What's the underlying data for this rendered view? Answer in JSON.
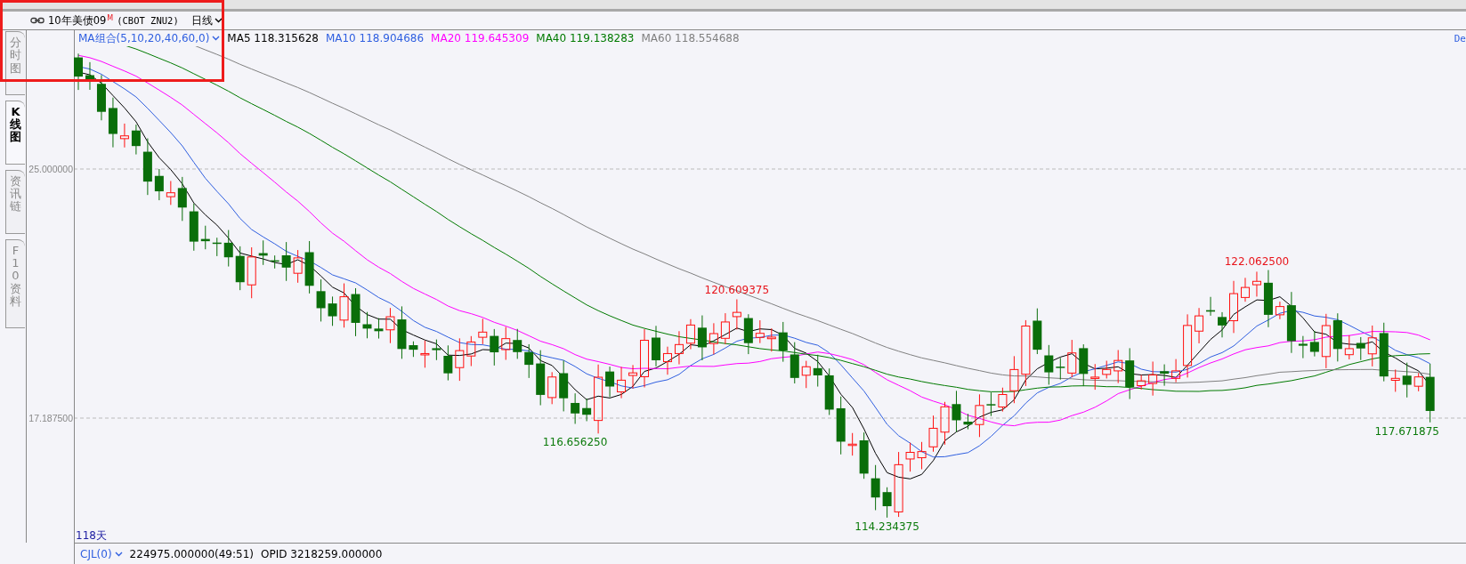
{
  "tabs": [
    {
      "label": "分时图",
      "selected": false
    },
    {
      "label": "K线图",
      "selected": true
    },
    {
      "label": "资讯链",
      "selected": false
    },
    {
      "label": "F10资料",
      "selected": false
    }
  ],
  "header": {
    "instrument": "10年美债09",
    "badge": "M",
    "code": "(CBOT ZNU2)",
    "period": "日线"
  },
  "legend": {
    "group": "MA组合(5,10,20,40,60,0)",
    "items": [
      {
        "label": "MA5 118.315628",
        "color": "#000000"
      },
      {
        "label": "MA10 118.904686",
        "color": "#2f5fe0"
      },
      {
        "label": "MA20 119.645309",
        "color": "#ff00ff"
      },
      {
        "label": "MA40 119.138283",
        "color": "#007a00"
      },
      {
        "label": "MA60 118.554688",
        "color": "#808080"
      }
    ],
    "corner": "De"
  },
  "y_axis": [
    "25.000000",
    "17.187500"
  ],
  "price_labels": [
    {
      "kind": "high",
      "text": "120.609375"
    },
    {
      "kind": "low",
      "text": "116.656250"
    },
    {
      "kind": "high",
      "text": "122.062500"
    },
    {
      "kind": "low",
      "text": "114.234375"
    },
    {
      "kind": "low",
      "text": "117.671875"
    }
  ],
  "day_count": "118天",
  "volume_bar": {
    "indicator": "CJL(0)",
    "value": "224975.000000(49:51)",
    "open_interest": "OPID 3218259.000000"
  }
}
